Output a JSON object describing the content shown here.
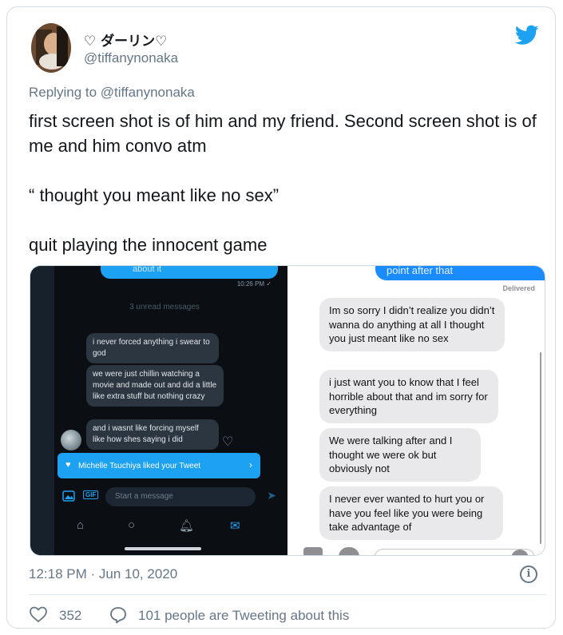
{
  "tweet": {
    "display_name": "♡ ダーリン♡",
    "handle": "@tiffanynonaka",
    "replying_to": "Replying to @tiffanynonaka",
    "text_lines": [
      "first screen shot is of him and my friend. Second screen shot is of me and him convo atm",
      "“ thought you meant like no sex”",
      "quit playing the innocent game"
    ],
    "timestamp": "12:18 PM · Jun 10, 2020",
    "like_count": "352",
    "retweet_text": "101 people are Tweeting about this",
    "brand_color": "#1da1f2"
  },
  "screenshot_left": {
    "top_bubble": "about it",
    "time": "10:26 PM ✓",
    "unread": "3 unread messages",
    "messages": [
      "i never forced anything i swear to god",
      "we were just chillin watching a movie and made out and did a little like extra stuff but nothing crazy",
      "and i wasnt like forcing myself like how shes saying i did"
    ],
    "notification": "Michelle Tsuchiya liked your Tweet",
    "composer_placeholder": "Start a message",
    "gif_label": "GIF"
  },
  "screenshot_right": {
    "sent_bubble": "point after that",
    "delivered": "Delivered",
    "messages": [
      "Im so sorry I didn’t realize you didn’t wanna do anything at all I thought you just meant like no sex",
      "i just want you to know that I feel horrible about that and im sorry for everything",
      "We were talking after and I thought we were ok but obviously not",
      "I never ever wanted to hurt you or have you feel like you were being take advantage of"
    ]
  },
  "icons": {
    "bird": "twitter-bird-icon",
    "info": "info-icon",
    "heart": "heart-icon",
    "reply": "speech-bubble-icon"
  }
}
